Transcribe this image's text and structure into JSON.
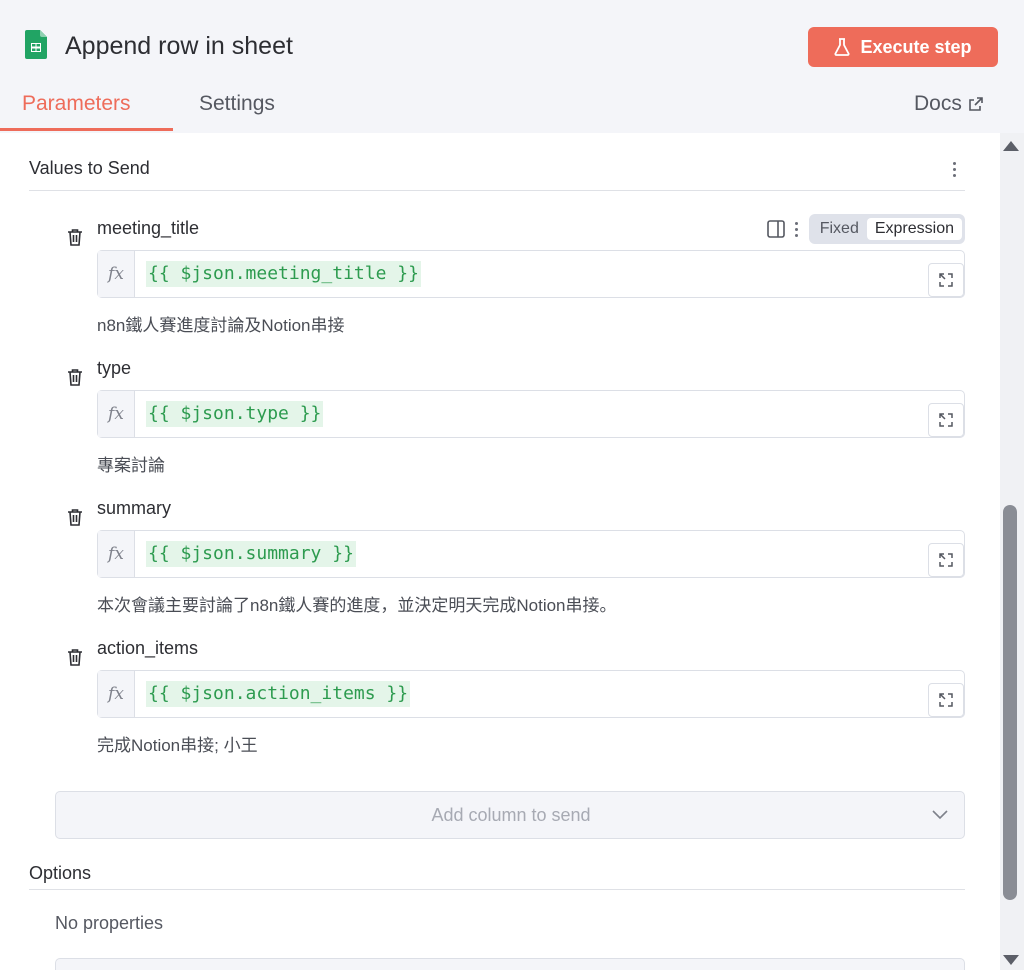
{
  "header": {
    "node_title": "Append row in sheet",
    "node_icon": "google-sheets-icon",
    "execute_label": "Execute step",
    "execute_icon": "flask-icon",
    "accent_color": "#ee6c5a"
  },
  "tabs": {
    "items": [
      {
        "label": "Parameters",
        "active": true
      },
      {
        "label": "Settings",
        "active": false
      }
    ],
    "docs_label": "Docs",
    "docs_icon": "external-link-icon"
  },
  "values_section": {
    "title": "Values to Send",
    "fields": [
      {
        "label": "meeting_title",
        "expression": "{{ $json.meeting_title }}",
        "preview": "n8n鐵人賽進度討論及Notion串接"
      },
      {
        "label": "type",
        "expression": "{{ $json.type }}",
        "preview": "專案討論"
      },
      {
        "label": "summary",
        "expression": "{{ $json.summary }}",
        "preview": "本次會議主要討論了n8n鐵人賽的進度，並決定明天完成Notion串接。"
      },
      {
        "label": "action_items",
        "expression": "{{ $json.action_items }}",
        "preview": "完成Notion串接; 小王"
      }
    ],
    "fx_label": "fx",
    "mode_fixed": "Fixed",
    "mode_expression": "Expression",
    "add_column_placeholder": "Add column to send"
  },
  "options_section": {
    "title": "Options",
    "empty_text": "No properties"
  }
}
